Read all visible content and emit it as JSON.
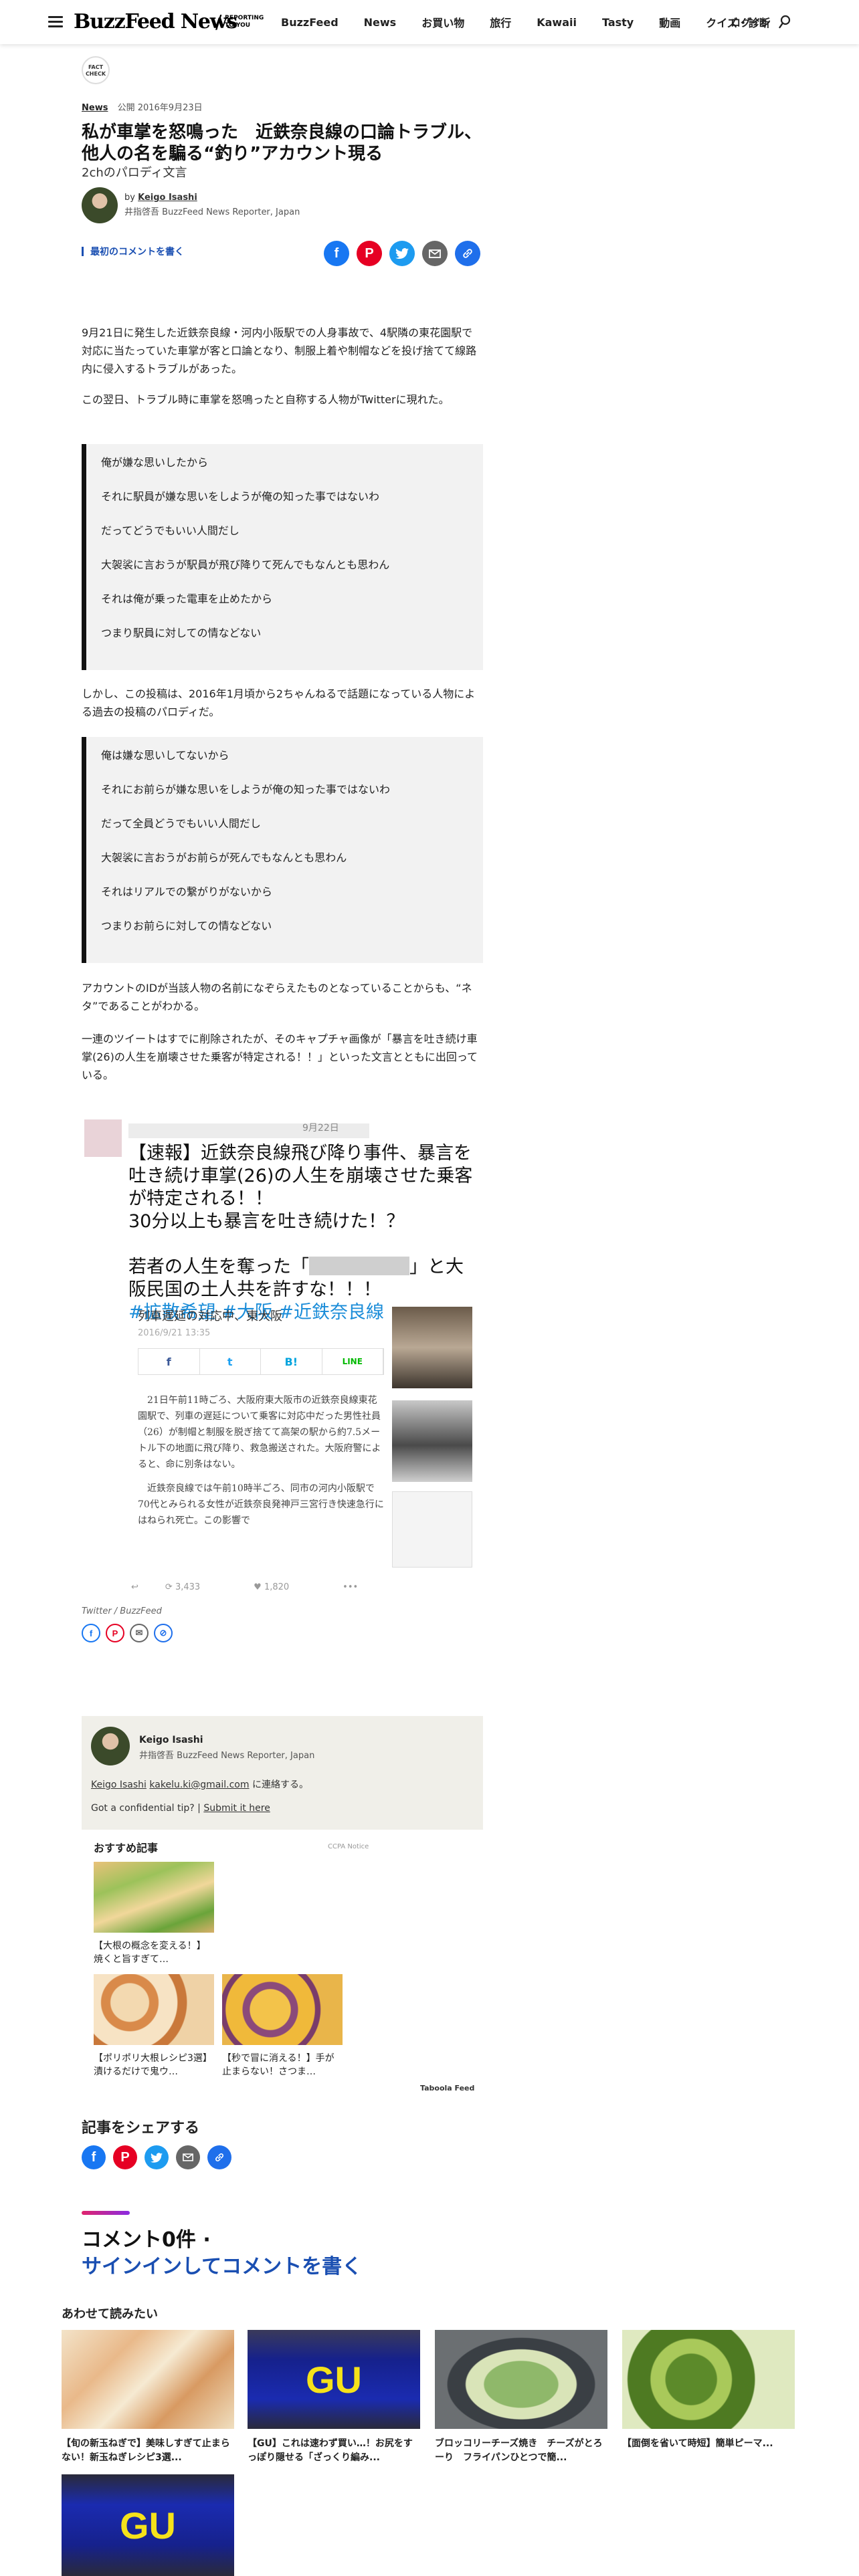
{
  "header": {
    "logo": "BuzzFeed News",
    "tagline": "REPORTING TO YOU",
    "nav": [
      "BuzzFeed",
      "News",
      "お買い物",
      "旅行",
      "Kawaii",
      "Tasty",
      "動画",
      "クイズ・診断"
    ],
    "login": "ログイン"
  },
  "article": {
    "factcheck": "FACT CHECK",
    "category": "News",
    "published": "公開 2016年9月23日",
    "title": "私が車掌を怒鳴った　近鉄奈良線の口論トラブル、他人の名を騙る“釣り”アカウント現る",
    "subtitle": "2chのパロディ文言",
    "byline_by": "by",
    "author_name": "Keigo Isashi",
    "author_role": "井指啓吾 BuzzFeed News Reporter, Japan",
    "comment_link": "最初のコメントを書く",
    "p1": "9月21日に発生した近鉄奈良線・河内小阪駅での人身事故で、4駅隣の東花園駅で対応に当たっていた車掌が客と口論となり、制服上着や制帽などを投げ捨てて線路内に侵入するトラブルがあった。",
    "p2": "この翌日、トラブル時に車掌を怒鳴ったと自称する人物がTwitterに現れた。",
    "quote1": [
      "俺が嫌な思いしたから",
      "それに駅員が嫌な思いをしようが俺の知った事ではないわ",
      "だってどうでもいい人間だし",
      "大袈裟に言おうが駅員が飛び降りて死んでもなんとも思わん",
      "それは俺が乗った電車を止めたから",
      "つまり駅員に対しての情などない"
    ],
    "p3": "しかし、この投稿は、2016年1月頃から2ちゃんねるで話題になっている人物による過去の投稿のパロディだ。",
    "quote2": [
      "俺は嫌な思いしてないから",
      "それにお前らが嫌な思いをしようが俺の知った事ではないわ",
      "だって全員どうでもいい人間だし",
      "大袈裟に言おうがお前らが死んでもなんとも思わん",
      "それはリアルでの繋がりがないから",
      "つまりお前らに対しての情などない"
    ],
    "p4": "アカウントのIDが当該人物の名前になぞらえたものとなっていることからも、“ネタ”であることがわかる。",
    "p5": "一連のツイートはすでに削除されたが、そのキャプチャ画像が「暴言を吐き続け車掌(26)の人生を崩壊させた乗客が特定される！！」といった文言とともに出回っている。"
  },
  "tweet": {
    "date": "9月22日",
    "line1": "【速報】近鉄奈良線飛び降り事件、暴言を吐き続け車掌(26)の人生を崩壊させた乗客が特定される！！",
    "line2": "30分以上も暴言を吐き続けた！？",
    "line3a": "若者の人生を奪った「",
    "line3b": "」と大阪民国の土人共を許すな！！！",
    "tags": "#拡散希望 #大阪 #近鉄奈良線",
    "np_head": "列車遅延の対応中、東大阪",
    "np_date": "2016/9/21 13:35",
    "np_share": [
      "f",
      "t",
      "B!",
      "LINE"
    ],
    "np_body1": "21日午前11時ごろ、大阪府東大阪市の近鉄奈良線東花園駅で、列車の遅延について乗客に対応中だった男性社員（26）が制帽と制服を脱ぎ捨てて高架の駅から約7.5メートル下の地面に飛び降り、救急搬送された。大阪府警によると、命に別条はない。",
    "np_body2": "近鉄奈良線では午前10時半ごろ、同市の河内小阪駅で70代とみられる女性が近鉄奈良発神戸三宮行き快速急行にはねられ死亡。この影響で",
    "retweets": "3,433",
    "likes": "1,820",
    "caption": "Twitter / BuzzFeed"
  },
  "author_box": {
    "name": "Keigo Isashi",
    "role": "井指啓吾 BuzzFeed News Reporter, Japan",
    "contact_name": "Keigo Isashi",
    "contact_email": "kakelu.ki@gmail.com",
    "contact_suffix": " に連絡する。",
    "tip_prefix": "Got a confidential tip? | ",
    "tip_link": "Submit it here"
  },
  "recommended": {
    "title": "おすすめ記事",
    "ccpa": "CCPA Notice",
    "items": [
      "【大根の概念を変える！】焼くと旨すぎて…",
      "【ポリポリ大根レシピ3選】漬けるだけで鬼ウ…",
      "【秒で冒に消える！】手が止まらない！さつま…"
    ],
    "taboola": "Taboola Feed"
  },
  "share_section": {
    "title": "記事をシェアする"
  },
  "comments": {
    "title": "コメント0件 ·",
    "signin": "サインインしてコメントを書く"
  },
  "also_read": {
    "title": "あわせて読みたい",
    "items": [
      "【旬の新玉ねぎで】美味しすぎて止まらない！新玉ねぎレシピ3選...",
      "【GU】これは速わず買い…！お尻をすっぽり隠せる「ざっくり編み...",
      "ブロッコリーチーズ焼き　チーズがとろーり　フライパンひとつで簡...",
      "【面倒を省いて時短】簡単ピーマ..."
    ],
    "gu_logo": "GU"
  },
  "colors": {
    "link_blue": "#1a4fb2",
    "facebook": "#1877f2",
    "pinterest": "#e60023",
    "twitter": "#1d9bf0",
    "quote_border": "#111111",
    "author_box_bg": "#f0efe9"
  },
  "icons": [
    "hamburger-icon",
    "search-icon",
    "facebook-icon",
    "pinterest-icon",
    "twitter-icon",
    "mail-icon",
    "link-icon"
  ]
}
